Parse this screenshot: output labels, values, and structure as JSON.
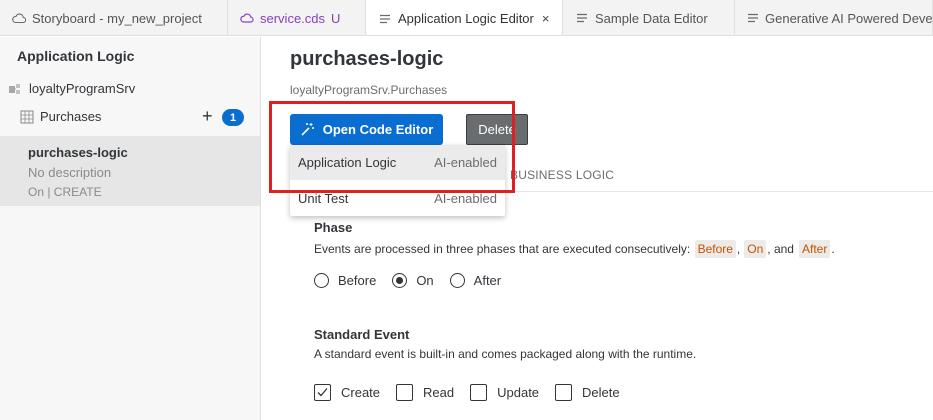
{
  "tabs": [
    {
      "label": "Storyboard - my_new_project",
      "icon": "cloud-icon",
      "active": false
    },
    {
      "label": "service.cds",
      "modified_marker": "U",
      "icon": "cds-icon",
      "active": false
    },
    {
      "label": "Application Logic Editor",
      "icon": "file-lines-icon",
      "active": true,
      "close": "×"
    },
    {
      "label": "Sample Data Editor",
      "icon": "file-lines-icon",
      "active": false
    },
    {
      "label": "Generative AI Powered Develo",
      "icon": "file-lines-icon",
      "active": false
    }
  ],
  "sidebar": {
    "title": "Application Logic",
    "service": "loyaltyProgramSrv",
    "entity": {
      "label": "Purchases",
      "add": "+",
      "count": "1"
    },
    "item": {
      "name": "purchases-logic",
      "description": "No description",
      "meta": "On | CREATE"
    }
  },
  "main": {
    "title": "purchases-logic",
    "subtitle": "loyaltyProgramSrv.Purchases",
    "open_code_editor": "Open Code Editor",
    "delete": "Delete",
    "business_logic_tab": "BUSINESS LOGIC",
    "dropdown": [
      {
        "label": "Application Logic",
        "badge": "AI-enabled"
      },
      {
        "label": "Unit Test",
        "badge": "AI-enabled"
      }
    ],
    "phase": {
      "heading": "Phase",
      "desc_prefix": "Events are processed in three phases that are executed consecutively: ",
      "chip_before": "Before",
      "sep1": ",",
      "chip_on": "On",
      "sep2": ", and",
      "chip_after": "After",
      "desc_suffix": ".",
      "options": [
        "Before",
        "On",
        "After"
      ],
      "selected": "On"
    },
    "standard_event": {
      "heading": "Standard Event",
      "desc": "A standard event is built-in and comes packaged along with the runtime.",
      "options": [
        "Create",
        "Read",
        "Update",
        "Delete"
      ],
      "checked": [
        "Create"
      ]
    }
  },
  "colors": {
    "accent": "#0a6ed1",
    "highlight": "#e02020",
    "chip_text": "#c35500"
  }
}
